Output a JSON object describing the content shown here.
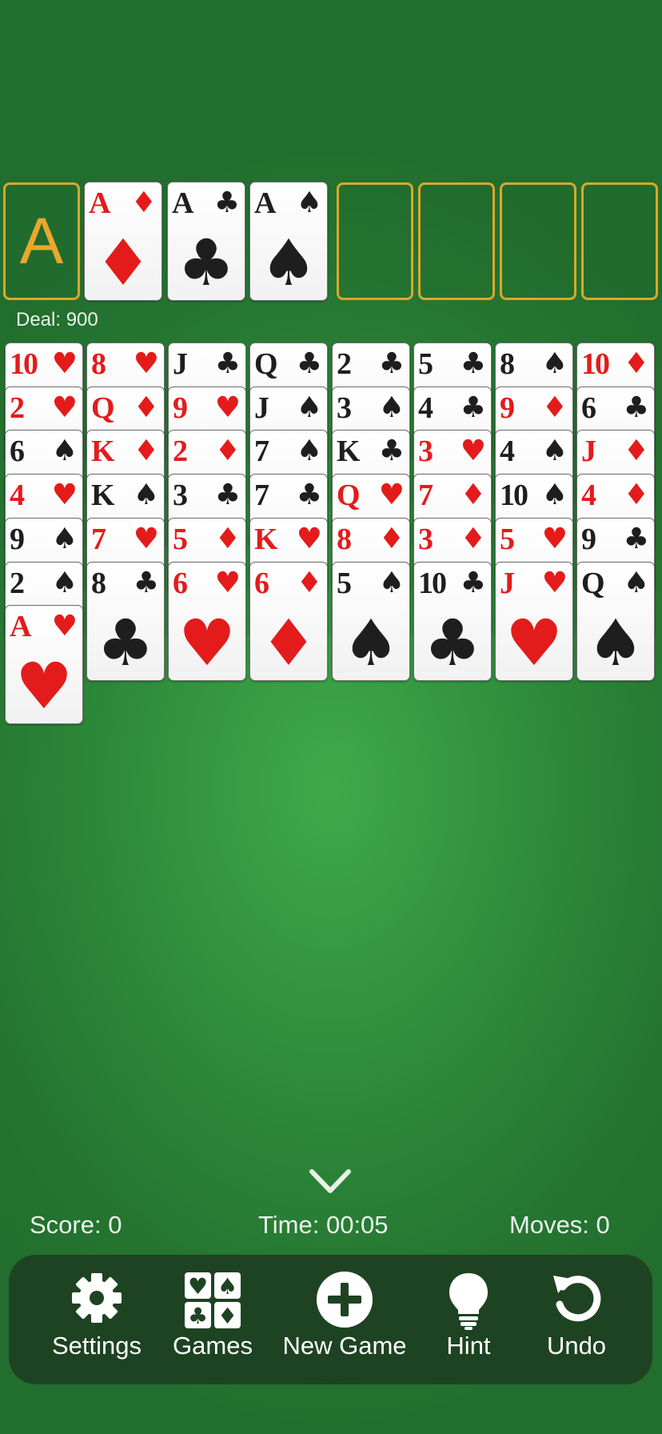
{
  "foundations": [
    {
      "placeholder": "A",
      "rank": "",
      "suit": ""
    },
    {
      "rank": "A",
      "suit": "♦",
      "color": "red"
    },
    {
      "rank": "A",
      "suit": "♣",
      "color": "black"
    },
    {
      "rank": "A",
      "suit": "♠",
      "color": "black"
    }
  ],
  "freecells": [
    {},
    {},
    {},
    {}
  ],
  "deal_label": "Deal: 900",
  "tableau": [
    [
      [
        "10",
        "♥"
      ],
      [
        "2",
        "♥"
      ],
      [
        "6",
        "♠"
      ],
      [
        "4",
        "♥"
      ],
      [
        "9",
        "♠"
      ],
      [
        "2",
        "♠"
      ],
      [
        "A",
        "♥"
      ]
    ],
    [
      [
        "8",
        "♥"
      ],
      [
        "Q",
        "♦"
      ],
      [
        "K",
        "♦"
      ],
      [
        "K",
        "♠"
      ],
      [
        "7",
        "♥"
      ],
      [
        "8",
        "♣"
      ]
    ],
    [
      [
        "J",
        "♣"
      ],
      [
        "9",
        "♥"
      ],
      [
        "2",
        "♦"
      ],
      [
        "3",
        "♣"
      ],
      [
        "5",
        "♦"
      ],
      [
        "6",
        "♥"
      ]
    ],
    [
      [
        "Q",
        "♣"
      ],
      [
        "J",
        "♠"
      ],
      [
        "7",
        "♠"
      ],
      [
        "7",
        "♣"
      ],
      [
        "K",
        "♥"
      ],
      [
        "6",
        "♦"
      ]
    ],
    [
      [
        "2",
        "♣"
      ],
      [
        "3",
        "♠"
      ],
      [
        "K",
        "♣"
      ],
      [
        "Q",
        "♥"
      ],
      [
        "8",
        "♦"
      ],
      [
        "5",
        "♠"
      ]
    ],
    [
      [
        "5",
        "♣"
      ],
      [
        "4",
        "♣"
      ],
      [
        "3",
        "♥"
      ],
      [
        "7",
        "♦"
      ],
      [
        "3",
        "♦"
      ],
      [
        "10",
        "♣"
      ]
    ],
    [
      [
        "8",
        "♠"
      ],
      [
        "9",
        "♦"
      ],
      [
        "4",
        "♠"
      ],
      [
        "10",
        "♠"
      ],
      [
        "5",
        "♥"
      ],
      [
        "J",
        "♥"
      ]
    ],
    [
      [
        "10",
        "♦"
      ],
      [
        "6",
        "♣"
      ],
      [
        "J",
        "♦"
      ],
      [
        "4",
        "♦"
      ],
      [
        "9",
        "♣"
      ],
      [
        "Q",
        "♠"
      ]
    ]
  ],
  "status": {
    "score": "Score: 0",
    "time": "Time: 00:05",
    "moves": "Moves: 0"
  },
  "toolbar": {
    "settings": "Settings",
    "games": "Games",
    "new_game": "New Game",
    "hint": "Hint",
    "undo": "Undo"
  },
  "colors": {
    "felt": "#2e8c3a",
    "toolbar_bg": "#1e4322",
    "slot_border": "#d8a82a",
    "red_suit": "#e41b1b",
    "black_suit": "#1e1e1e"
  },
  "icons": {
    "settings": "gear-icon",
    "games": "card-suits-icon",
    "new_game": "plus-circle-icon",
    "hint": "lightbulb-icon",
    "undo": "undo-arrow-icon",
    "collapse": "chevron-down-icon"
  }
}
